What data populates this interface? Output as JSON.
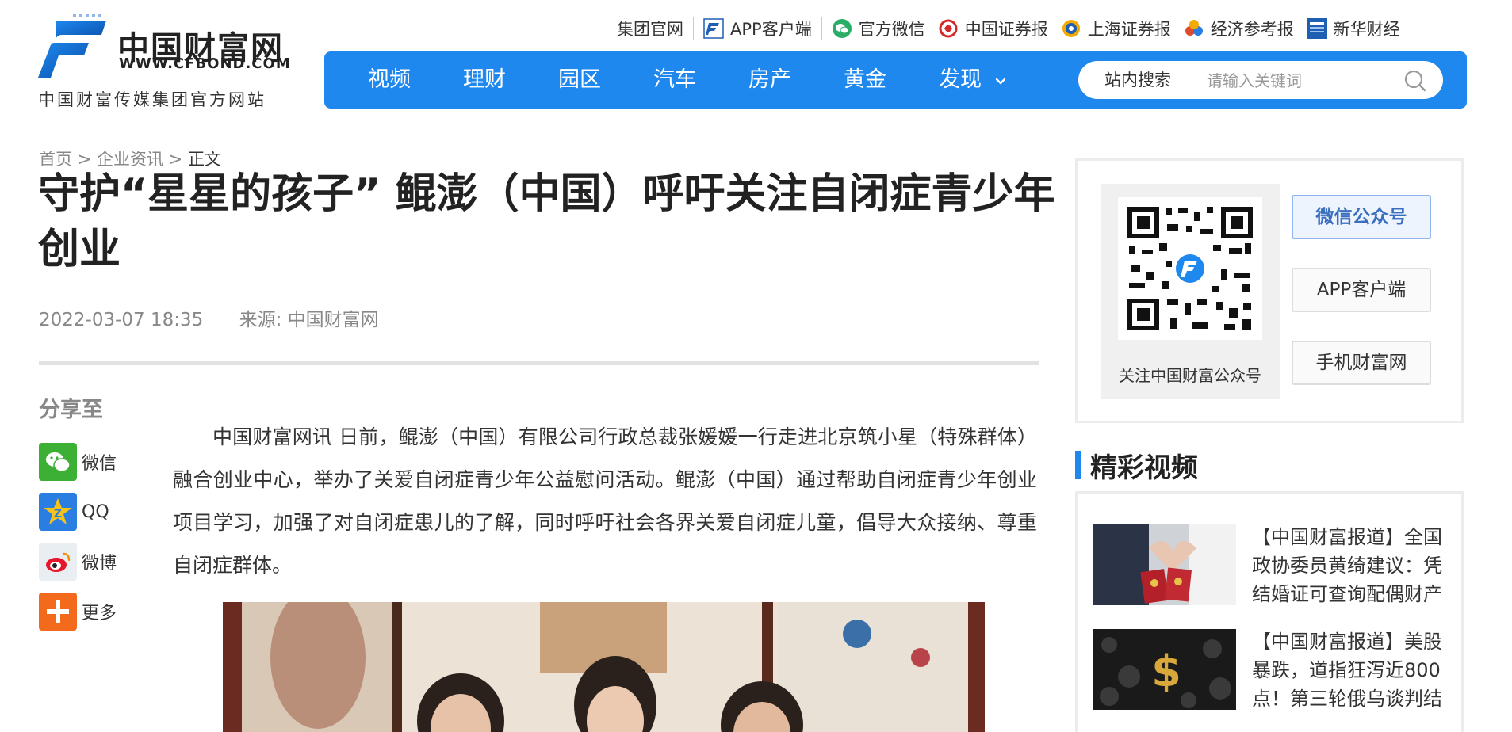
{
  "site": {
    "logo_name": "中国财富网",
    "logo_url": "WWW.CFBOND.COM",
    "slogan": "中国财富传媒集团官方网站"
  },
  "toplinks": [
    {
      "label": "集团官网",
      "icon": "none"
    },
    {
      "label": "APP客户端",
      "icon": "cfbond-app-icon"
    },
    {
      "label": "官方微信",
      "icon": "wechat-icon"
    },
    {
      "label": "中国证券报",
      "icon": "cs-news-icon"
    },
    {
      "label": "上海证券报",
      "icon": "sh-news-icon"
    },
    {
      "label": "经济参考报",
      "icon": "jjckb-icon"
    },
    {
      "label": "新华财经",
      "icon": "xinhua-icon"
    }
  ],
  "nav": {
    "items": [
      "视频",
      "理财",
      "园区",
      "汽车",
      "房产",
      "黄金",
      "发现"
    ],
    "search_label": "站内搜索",
    "search_placeholder": "请输入关键词"
  },
  "breadcrumb": {
    "home": "首页",
    "section": "企业资讯",
    "current": "正文",
    "sep": ">"
  },
  "article": {
    "title": "守护“星星的孩子” 鲲澎（中国）呼吁关注自闭症青少年创业",
    "date": "2022-03-07 18:35",
    "source": "来源: 中国财富网",
    "paragraph": "中国财富网讯 日前，鲲澎（中国）有限公司行政总裁张媛媛一行走进北京筑小星（特殊群体）融合创业中心，举办了关爱自闭症青少年公益慰问活动。鲲澎（中国）通过帮助自闭症青少年创业项目学习，加强了对自闭症患儿的了解，同时呼吁社会各界关爱自闭症儿童，倡导大众接纳、尊重自闭症群体。"
  },
  "share": {
    "title": "分享至",
    "items": [
      {
        "label": "微信",
        "icon": "wechat-share-icon"
      },
      {
        "label": "QQ",
        "icon": "qq-icon"
      },
      {
        "label": "微博",
        "icon": "weibo-icon"
      },
      {
        "label": "更多",
        "icon": "plus-icon"
      }
    ]
  },
  "sidebar": {
    "qr_caption": "关注中国财富公众号",
    "buttons": [
      "微信公众号",
      "APP客户端",
      "手机财富网"
    ],
    "video_heading": "精彩视频",
    "videos": [
      {
        "title": "【中国财富报道】全国政协委员黄绮建议：凭结婚证可查询配偶财产"
      },
      {
        "title": "【中国财富报道】美股暴跌，道指狂泻近800点！第三轮俄乌谈判结"
      }
    ]
  },
  "colors": {
    "nav_blue": "#1e88ef",
    "accent_bar": "#1e88ef"
  }
}
